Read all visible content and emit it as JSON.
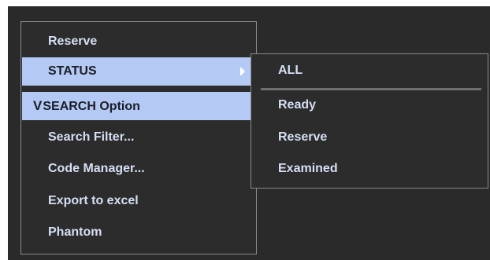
{
  "menu": {
    "items": [
      {
        "label": "Reserve"
      },
      {
        "label": "STATUS"
      },
      {
        "label": "SEARCH Option"
      },
      {
        "label": "Search Filter..."
      },
      {
        "label": "Code Manager..."
      },
      {
        "label": "Export to excel"
      },
      {
        "label": "Phantom"
      }
    ],
    "check_glyph": "V"
  },
  "submenu": {
    "items": [
      {
        "label": "ALL"
      },
      {
        "label": "Ready"
      },
      {
        "label": "Reserve"
      },
      {
        "label": "Examined"
      }
    ]
  },
  "colors": {
    "background": "#2a2a2a",
    "highlight": "#b4c9f3",
    "text": "#d6dff4"
  }
}
